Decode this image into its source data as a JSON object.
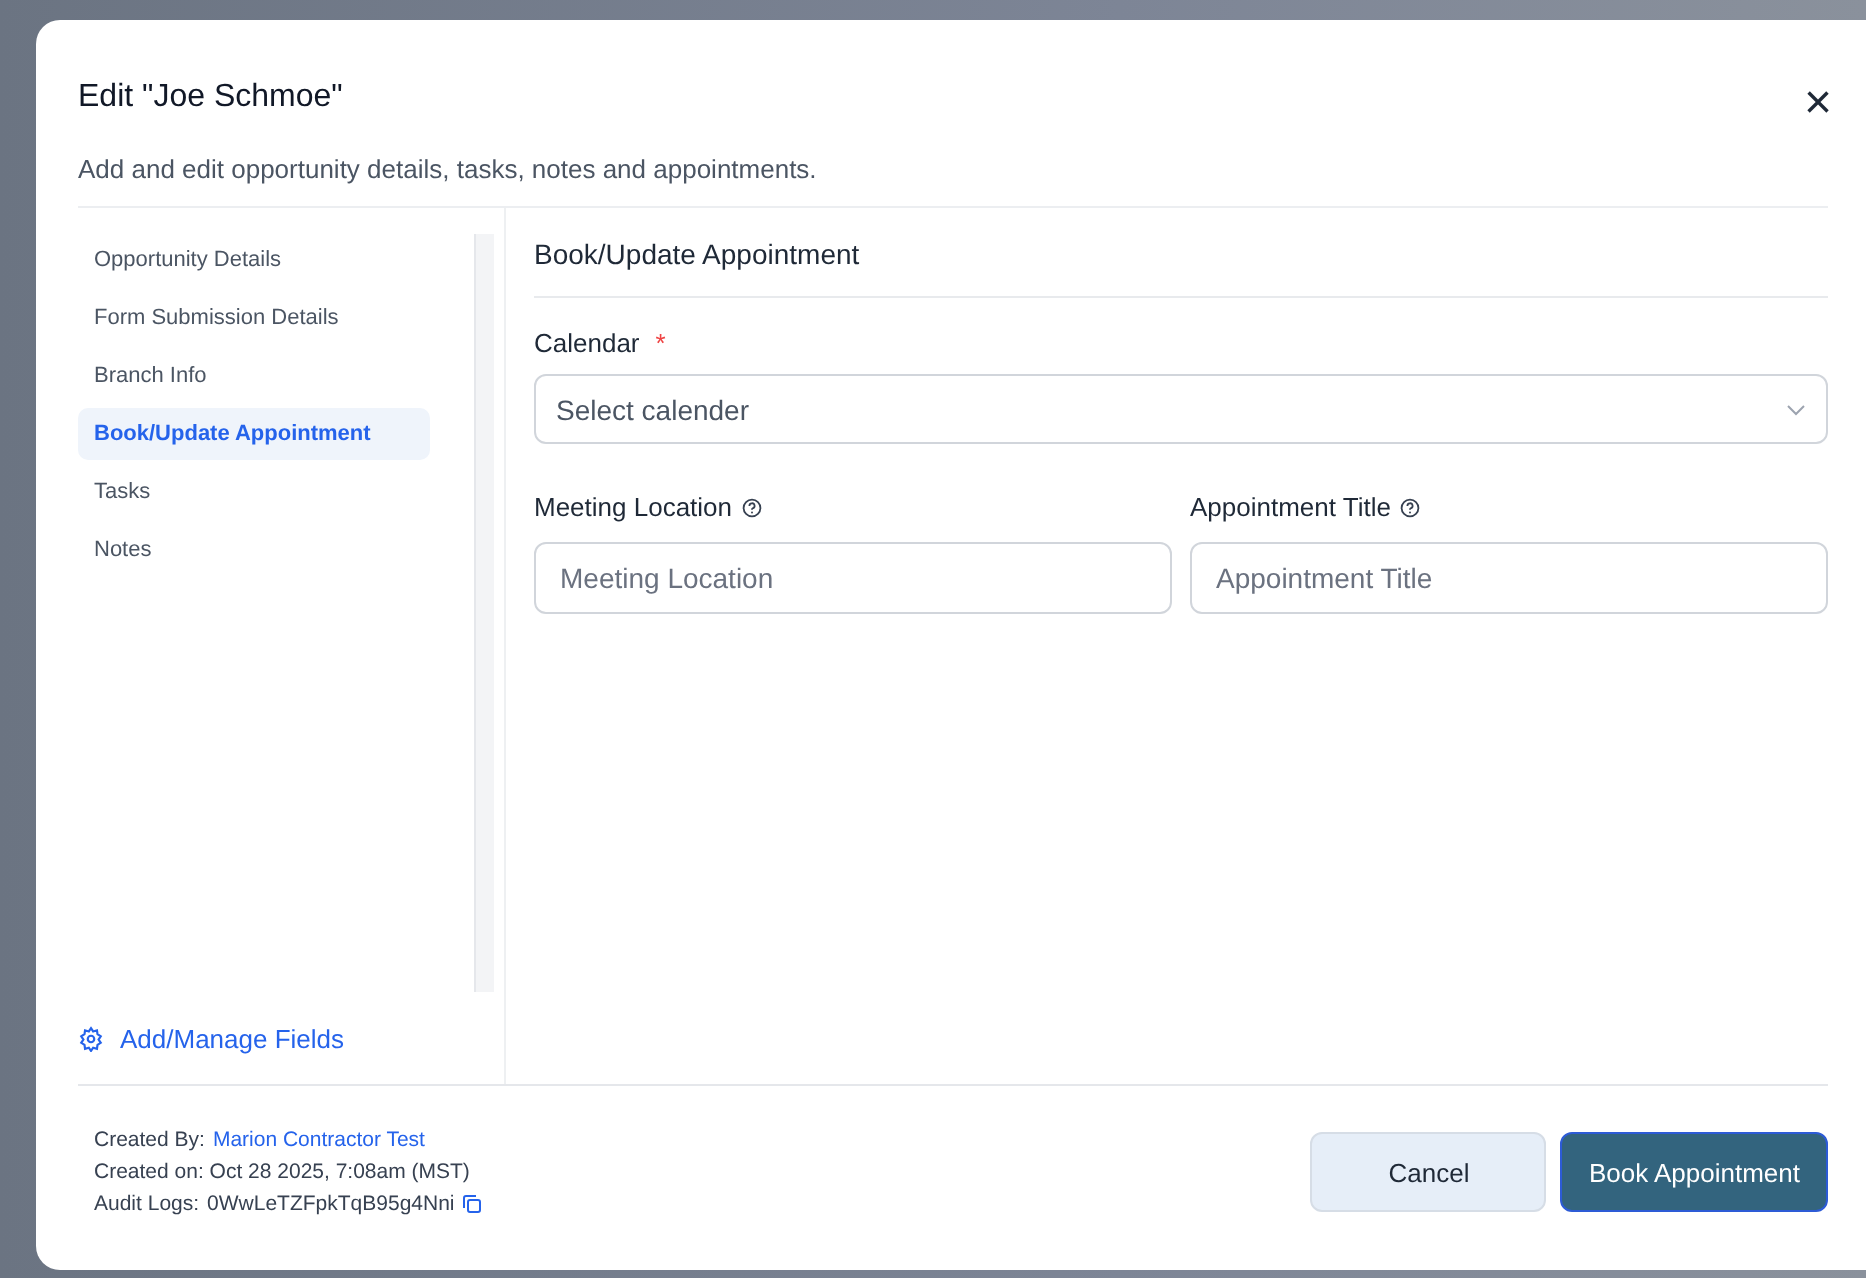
{
  "dialog": {
    "title": "Edit \"Joe Schmoe\"",
    "close": "×",
    "subtitle": "Add and edit opportunity details, tasks, notes and appointments."
  },
  "sidebar": {
    "items": [
      {
        "label": "Opportunity Details",
        "selected": false
      },
      {
        "label": "Form Submission Details",
        "selected": false
      },
      {
        "label": "Branch Info",
        "selected": false
      },
      {
        "label": "Book/Update Appointment",
        "selected": true
      },
      {
        "label": "Tasks",
        "selected": false
      },
      {
        "label": "Notes",
        "selected": false
      }
    ],
    "manage_link": "Add/Manage Fields"
  },
  "section": {
    "title": "Book/Update Appointment",
    "calendar": {
      "label": "Calendar",
      "required": true,
      "required_mark": "*",
      "placeholder": "Select calender"
    },
    "fields": [
      {
        "label": "Meeting Location",
        "placeholder": "Meeting Location"
      },
      {
        "label": "Appointment Title",
        "placeholder": "Appointment Title"
      }
    ]
  },
  "footer": {
    "created_by_label": "Created By:",
    "created_by": "Marion Contractor Test",
    "created_on": "Created on: Oct 28 2025, 7:08am (MST)",
    "audit_label": "Audit Logs:",
    "audit_id": "0WwLeTZFpkTqB95g4Nni"
  },
  "buttons": [
    {
      "label": "Cancel",
      "kind": "secondary"
    },
    {
      "label": "Book Appointment",
      "kind": "primary"
    }
  ]
}
